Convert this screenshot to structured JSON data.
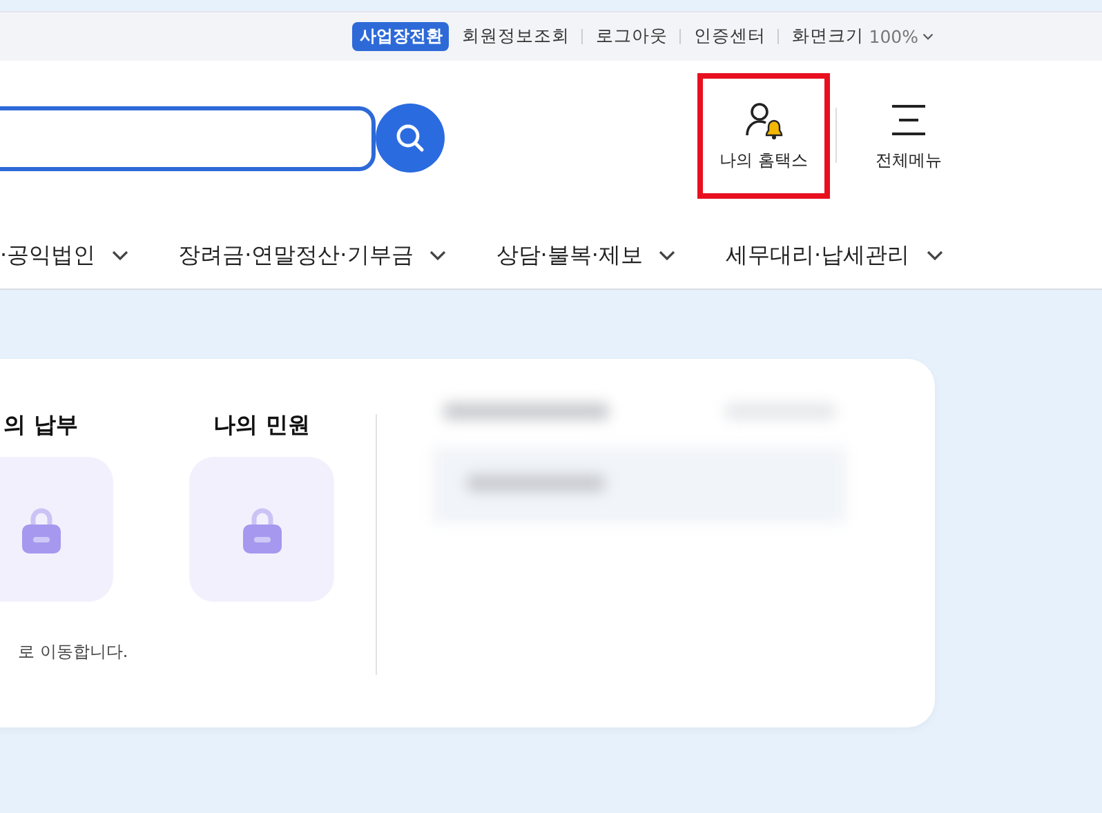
{
  "top_links": [
    {
      "label": "사업장전환",
      "kind": "badge"
    },
    {
      "label": "회원정보조회",
      "kind": "link"
    },
    {
      "label": "로그아웃",
      "kind": "link"
    },
    {
      "label": "인증센터",
      "kind": "link"
    }
  ],
  "zoom": {
    "label": "화면크기",
    "value": "100%"
  },
  "header_buttons": [
    {
      "label": "나의 홈택스",
      "kind": "person-bell",
      "highlighted": true
    },
    {
      "label": "전체메뉴",
      "kind": "menu",
      "highlighted": false
    }
  ],
  "nav": [
    "·공익법인",
    "장려금·연말정산·기부금",
    "상담·불복·제보",
    "세무대리·납세관리"
  ],
  "shortcuts": [
    {
      "title": "의 납부",
      "locked": true
    },
    {
      "title": "나의 민원",
      "locked": true
    }
  ],
  "note": "로 이동합니다."
}
